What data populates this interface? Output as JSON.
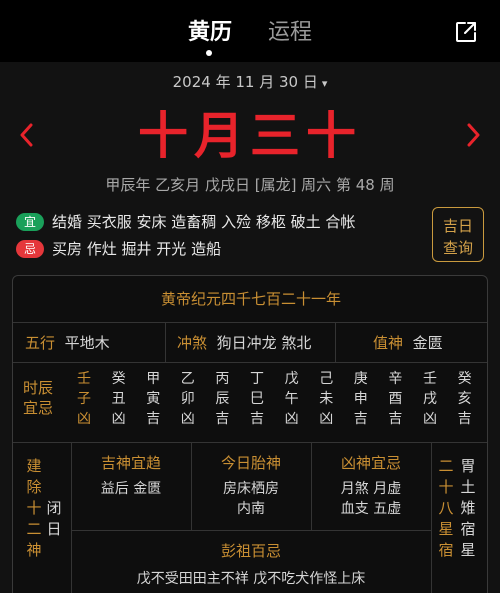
{
  "tabs": [
    {
      "label": "黄历"
    },
    {
      "label": "运程"
    }
  ],
  "date_selector": {
    "label": "2024 年 11 月 30 日",
    "chevron": "chevron-down-icon"
  },
  "lunar_date": "十月三十",
  "ganzhi_line": "甲辰年 乙亥月 戊戌日 [属龙] 周六  第 48 周",
  "yi": {
    "badge": "宜",
    "items": "结婚 买衣服 安床 造畜稠 入殓 移柩 破土 合帐"
  },
  "ji": {
    "badge": "忌",
    "items": "买房 作灶 掘井 开光 造船"
  },
  "jiri_button": {
    "line1": "吉日",
    "line2": "查询"
  },
  "huangdi": "黄帝纪元四千七百二十一年",
  "wuxing": {
    "label": "五行",
    "value": "平地木"
  },
  "chongsha": {
    "label": "冲煞",
    "value": "狗日冲龙 煞北"
  },
  "zhishen": {
    "label": "值神",
    "value": "金匮"
  },
  "shichen": {
    "label_line1": "时辰",
    "label_line2": "宜忌",
    "hours": [
      {
        "gan": "壬",
        "zhi": "子",
        "luck": "凶"
      },
      {
        "gan": "癸",
        "zhi": "丑",
        "luck": "凶"
      },
      {
        "gan": "甲",
        "zhi": "寅",
        "luck": "吉"
      },
      {
        "gan": "乙",
        "zhi": "卯",
        "luck": "凶"
      },
      {
        "gan": "丙",
        "zhi": "辰",
        "luck": "吉"
      },
      {
        "gan": "丁",
        "zhi": "巳",
        "luck": "吉"
      },
      {
        "gan": "戊",
        "zhi": "午",
        "luck": "凶"
      },
      {
        "gan": "己",
        "zhi": "未",
        "luck": "凶"
      },
      {
        "gan": "庚",
        "zhi": "申",
        "luck": "吉"
      },
      {
        "gan": "辛",
        "zhi": "酉",
        "luck": "吉"
      },
      {
        "gan": "壬",
        "zhi": "戌",
        "luck": "凶"
      },
      {
        "gan": "癸",
        "zhi": "亥",
        "luck": "吉"
      }
    ]
  },
  "jianchu": {
    "label": [
      "建",
      "除",
      "十",
      "二",
      "神"
    ],
    "value": [
      "闭",
      "日"
    ]
  },
  "jishen": {
    "title": "吉神宜趋",
    "body": "益后 金匮"
  },
  "taishen": {
    "title": "今日胎神",
    "line1": "房床栖房",
    "line2": "内南"
  },
  "xiongshen": {
    "title": "凶神宜忌",
    "line1": "月煞 月虚",
    "line2": "血支 五虚"
  },
  "xiu": {
    "label": [
      "二",
      "十",
      "八",
      "星",
      "宿"
    ],
    "value": [
      "胃",
      "土",
      "雉",
      "宿",
      "星"
    ]
  },
  "pengzu": {
    "title": "彭祖百忌",
    "body": "戊不受田田主不祥 戊不吃犬作怪上床"
  },
  "colors": {
    "accent_red": "#e8232b",
    "gold": "#c98f33",
    "green": "#1aa05a"
  }
}
